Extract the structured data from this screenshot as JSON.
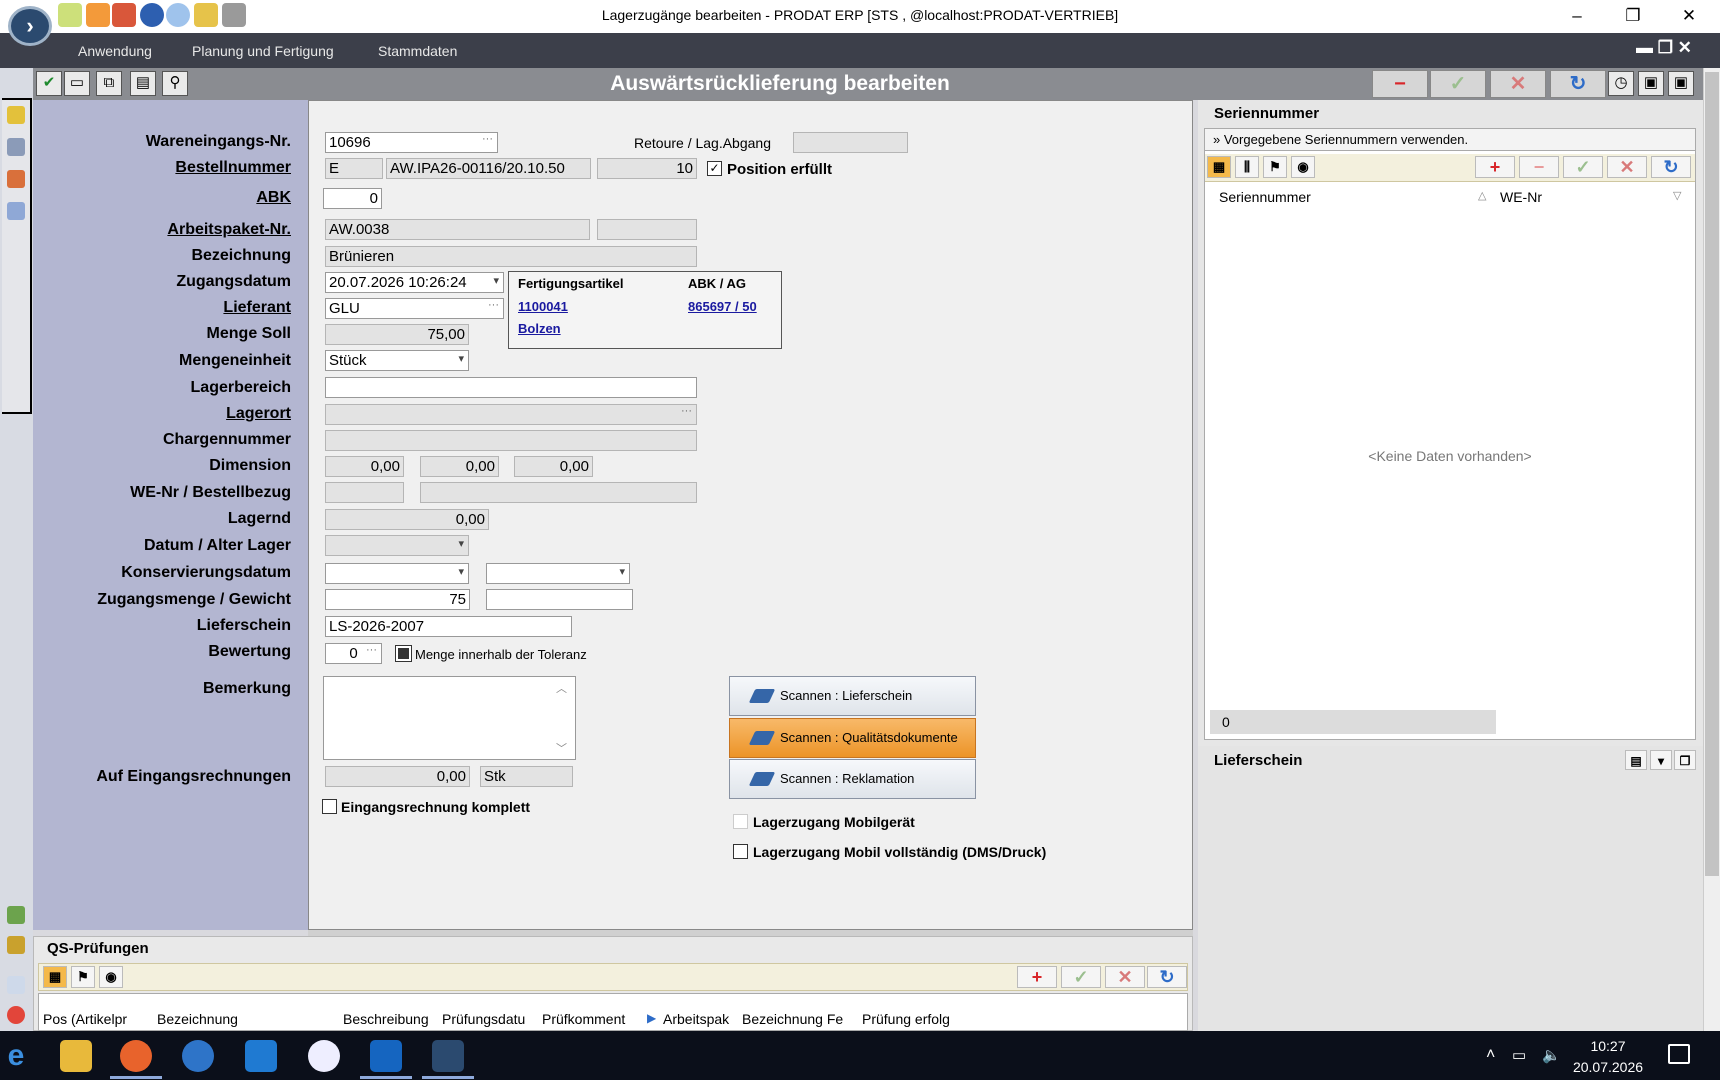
{
  "window": {
    "title": "Lagerzugänge bearbeiten - PRODAT ERP   [STS , @localhost:PRODAT-VERTRIEB]",
    "minimize": "–",
    "restore": "❐",
    "close": "✕"
  },
  "menu": {
    "items": [
      "Anwendung",
      "Planung und Fertigung",
      "Stammdaten"
    ],
    "mdi_controls": "▬ ❐ ✕"
  },
  "form": {
    "title": "Auswärtsrücklieferung bearbeiten",
    "labels": {
      "wareneingang": "Wareneingangs-Nr.",
      "bestellnummer": "Bestellnummer",
      "abk": "ABK",
      "arbeitspaket": "Arbeitspaket-Nr.",
      "bezeichnung": "Bezeichnung",
      "zugangsdatum": "Zugangsdatum",
      "lieferant": "Lieferant",
      "menge_soll": "Menge Soll",
      "mengeneinheit": "Mengeneinheit",
      "lagerbereich": "Lagerbereich",
      "lagerort": "Lagerort",
      "chargennummer": "Chargennummer",
      "dimension": "Dimension",
      "we_nr": "WE-Nr / Bestellbezug",
      "lagernd": "Lagernd",
      "datum_alter": "Datum / Alter Lager",
      "konservierung": "Konservierungsdatum",
      "zugangsmenge": "Zugangsmenge / Gewicht",
      "lieferschein": "Lieferschein",
      "bewertung": "Bewertung",
      "bemerkung": "Bemerkung",
      "eingangsrechnungen": "Auf Eingangsrechnungen",
      "retoure": "Retoure / Lag.Abgang"
    },
    "values": {
      "wareneingang": "10696",
      "best_typ": "E",
      "best_nr": "AW.IPA26-00116/20.10.50",
      "best_pos": "10",
      "abk": "0",
      "arbeitspaket": "AW.0038",
      "bezeichnung": "Brünieren",
      "zugangsdatum": "20.07.2026 10:26:24",
      "lieferant": "GLU",
      "menge_soll": "75,00",
      "mengeneinheit": "Stück",
      "dim1": "0,00",
      "dim2": "0,00",
      "dim3": "0,00",
      "lagernd": "0,00",
      "zugangsmenge": "75",
      "lieferschein": "LS-2026-2007",
      "bewertung": "0",
      "eingangsrechnungen": "0,00",
      "einheit": "Stk"
    },
    "checks": {
      "position_erfuellt": "Position erfüllt",
      "menge_toleranz": "Menge innerhalb der Toleranz",
      "eingangsrechnung_komplett": "Eingangsrechnung komplett",
      "lagerzugang_mobil": "Lagerzugang Mobilgerät",
      "lagerzugang_mobil_voll": "Lagerzugang Mobil vollständig (DMS/Druck)"
    },
    "fertigung": {
      "h1": "Fertigungsartikel",
      "h2": "ABK / AG",
      "artikel": "1100041",
      "abk_ag": "865697 / 50",
      "name": "Bolzen"
    },
    "scan_buttons": [
      "Scannen : Lieferschein",
      "Scannen : Qualitätsdokumente",
      "Scannen : Reklamation"
    ]
  },
  "serien": {
    "title": "Seriennummer",
    "info": "Vorgegebene Seriennummern verwenden.",
    "col1": "Seriennummer",
    "col2": "WE-Nr",
    "empty": "<Keine Daten vorhanden>",
    "count": "0"
  },
  "lieferschein_panel": {
    "title": "Lieferschein"
  },
  "qs": {
    "title": "QS-Prüfungen",
    "columns": [
      "Pos (Artikelpr",
      "Bezeichnung",
      "Beschreibung",
      "Prüfungsdatu",
      "Prüfkomment",
      "Arbeitspak",
      "Bezeichnung Fe",
      "Prüfung erfolg"
    ]
  },
  "taskbar": {
    "time": "10:27",
    "date": "20.07.2026"
  },
  "colors": {
    "label_bg": "#b3b6d1",
    "title_bg": "#8a8c91",
    "menu_bg": "#3c3f4a",
    "accent_orange": "#ec9428",
    "link": "#1a1aa0"
  }
}
